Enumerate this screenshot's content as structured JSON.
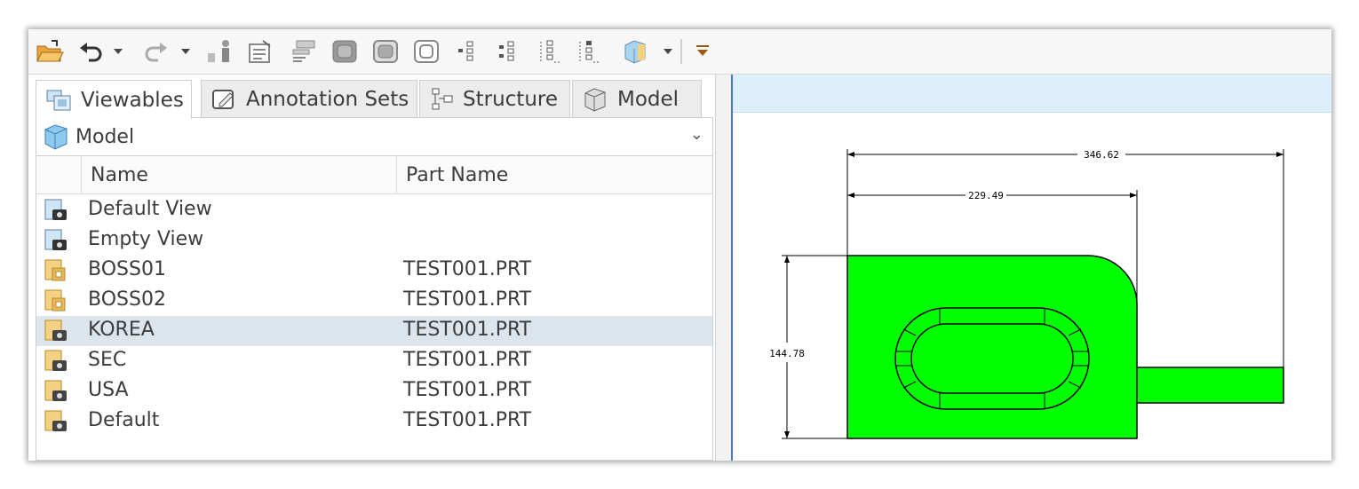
{
  "toolbar": {
    "icons": [
      "open-folder-icon",
      "undo-icon",
      "undo-dropdown-icon",
      "redo-icon",
      "redo-dropdown-icon",
      "person-icon",
      "properties-icon",
      "list-properties-icon",
      "view-shaded-icon",
      "view-hidden-icon",
      "view-wireframe-icon",
      "tree-icon-1",
      "tree-icon-2",
      "tree-icon-3",
      "tree-icon-4",
      "cube-appearance-icon",
      "cube-dropdown-icon",
      "toolbar-overflow-icon"
    ]
  },
  "tabs": [
    {
      "label": "Viewables",
      "icon": "viewables-icon",
      "active": true
    },
    {
      "label": "Annotation Sets",
      "icon": "annotation-icon",
      "active": false
    },
    {
      "label": "Structure",
      "icon": "structure-icon",
      "active": false
    },
    {
      "label": "Model",
      "icon": "model-cube-icon",
      "active": false
    }
  ],
  "model_header": {
    "label": "Model",
    "icon": "model-cube-icon"
  },
  "table": {
    "columns": [
      "Name",
      "Part Name"
    ],
    "rows": [
      {
        "name": "Default View",
        "part": "",
        "icon": "camera-view-icon"
      },
      {
        "name": "Empty View",
        "part": "",
        "icon": "camera-view-icon"
      },
      {
        "name": "BOSS01",
        "part": "TEST001.PRT",
        "icon": "boss-view-icon"
      },
      {
        "name": "BOSS02",
        "part": "TEST001.PRT",
        "icon": "boss-view-icon"
      },
      {
        "name": "KOREA",
        "part": "TEST001.PRT",
        "icon": "saved-view-icon"
      },
      {
        "name": "SEC",
        "part": "TEST001.PRT",
        "icon": "saved-view-icon"
      },
      {
        "name": "USA",
        "part": "TEST001.PRT",
        "icon": "saved-view-icon"
      },
      {
        "name": "Default",
        "part": "TEST001.PRT",
        "icon": "saved-view-icon"
      }
    ],
    "selected_index": 4
  },
  "drawing": {
    "dim_overall": "346.62",
    "dim_partial": "229.49",
    "dim_height": "144.78",
    "part_color": "#00ff00"
  },
  "colors": {
    "accent": "#4a78c8",
    "viewport_header": "#dceffb",
    "selection": "#dde5ec"
  }
}
